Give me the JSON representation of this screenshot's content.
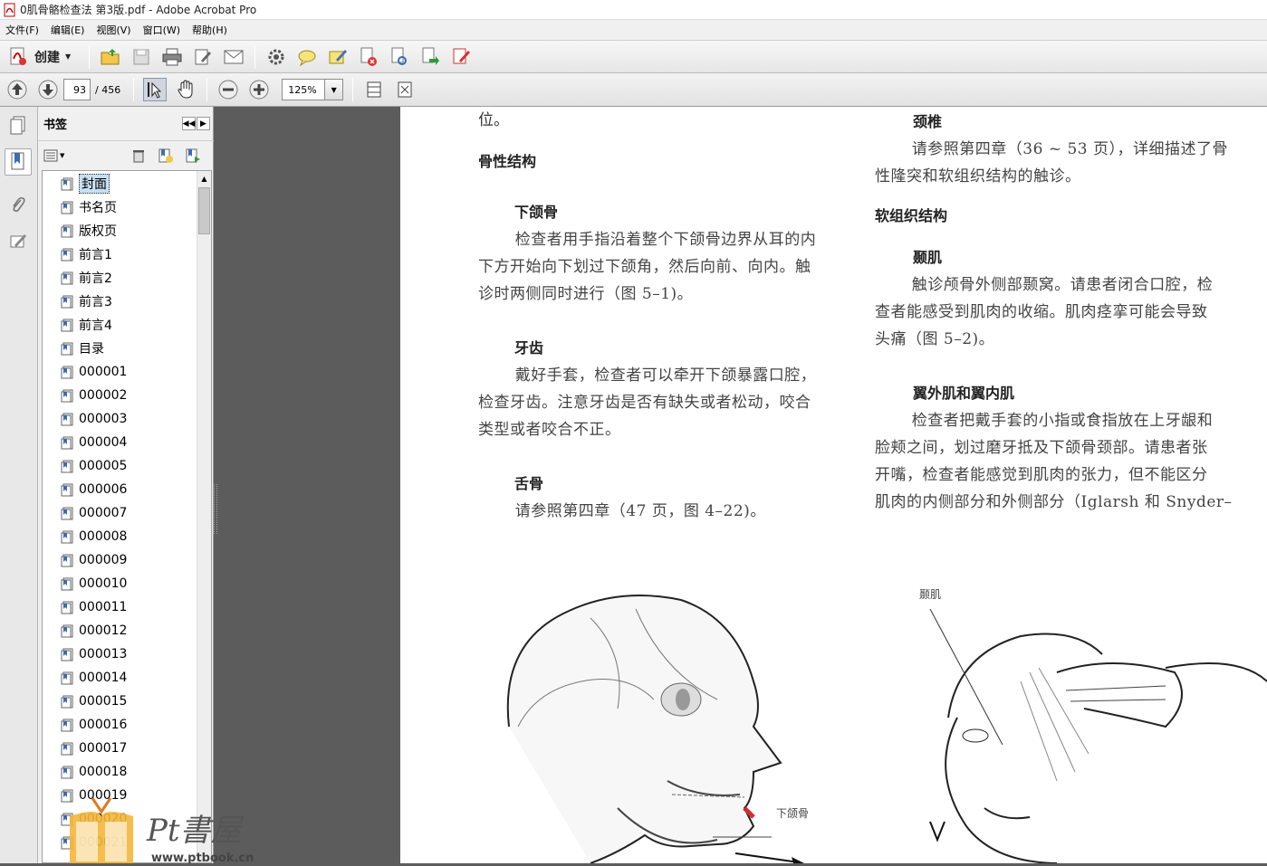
{
  "window": {
    "title": "0肌骨骼检查法  第3版.pdf - Adobe Acrobat Pro"
  },
  "menu": [
    "文件(F)",
    "编辑(E)",
    "视图(V)",
    "窗口(W)",
    "帮助(H)"
  ],
  "toolbar": {
    "create_label": "创建"
  },
  "nav": {
    "current_page": "93",
    "total_pages": "/ 456",
    "zoom": "125%"
  },
  "bookmarks": {
    "title": "书签",
    "items": [
      "封面",
      "书名页",
      "版权页",
      "前言1",
      "前言2",
      "前言3",
      "前言4",
      "目录",
      "000001",
      "000002",
      "000003",
      "000004",
      "000005",
      "000006",
      "000007",
      "000008",
      "000009",
      "000010",
      "000011",
      "000012",
      "000013",
      "000014",
      "000015",
      "000016",
      "000017",
      "000018",
      "000019",
      "000020",
      "000021"
    ],
    "selected": "封面"
  },
  "doc": {
    "left": {
      "top_fragment": "位。",
      "h_bone": "骨性结构",
      "h_mandible": "下颌骨",
      "p_mandible": [
        "检查者用手指沿着整个下颌骨边界从耳的内",
        "下方开始向下划过下颌角，然后向前、向内。触",
        "诊时两侧同时进行（图 5–1)。"
      ],
      "h_teeth": "牙齿",
      "p_teeth": [
        "戴好手套，检查者可以牵开下颌暴露口腔，",
        "检查牙齿。注意牙齿是否有缺失或者松动，咬合",
        "类型或者咬合不正。"
      ],
      "h_hyoid": "舌骨",
      "p_hyoid": "请参照第四章（47 页，图 4–22)。"
    },
    "right": {
      "h_cervical": "颈椎",
      "p_cervical": [
        "请参照第四章（36 ~ 53 页），详细描述了骨",
        "性隆突和软组织结构的触诊。"
      ],
      "h_soft": "软组织结构",
      "h_temporalis": "颞肌",
      "p_temporalis": [
        "触诊颅骨外侧部颞窝。请患者闭合口腔，检",
        "查者能感受到肌肉的收缩。肌肉痉挛可能会导致",
        "头痛（图 5–2)。"
      ],
      "h_pterygoid": "翼外肌和翼内肌",
      "p_pterygoid": [
        "检查者把戴手套的小指或食指放在上牙龈和",
        "脸颊之间，划过磨牙抵及下颌骨颈部。请患者张",
        "开嘴，检查者能感觉到肌肉的张力，但不能区分",
        "肌肉的内侧部分和外侧部分（Iglarsh 和 Snyder–"
      ]
    },
    "fig1_label": "下颌骨",
    "fig2_label": "颞肌"
  },
  "watermark": {
    "text": "Pt書屋",
    "url": "www.ptbook.cn"
  }
}
